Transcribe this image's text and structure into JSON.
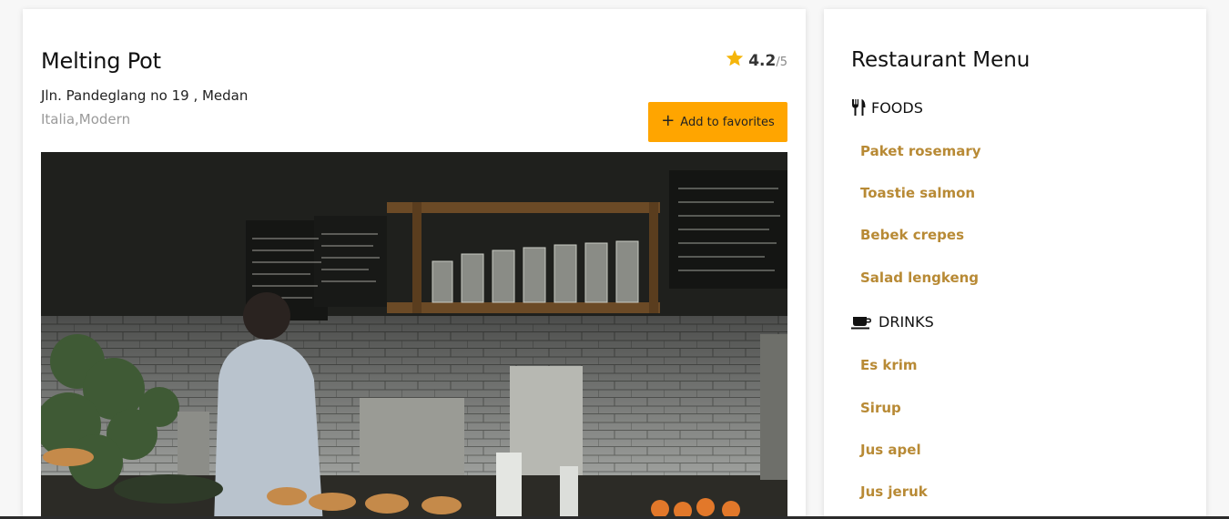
{
  "restaurant": {
    "name": "Melting Pot",
    "address": "Jln. Pandeglang no 19 , Medan",
    "cuisine": "Italia,Modern",
    "rating": "4.2",
    "rating_scale": "/5",
    "favorite_label": "Add to favorites",
    "favorite_icon": "plus-icon",
    "accent_color": "#ffa500",
    "star_color": "#f5b50a"
  },
  "menu": {
    "title": "Restaurant Menu",
    "item_color": "#b88a35",
    "foods": {
      "label": "FOODS",
      "icon": "utensils-icon",
      "items": [
        "Paket rosemary",
        "Toastie salmon",
        "Bebek crepes",
        "Salad lengkeng"
      ]
    },
    "drinks": {
      "label": "DRINKS",
      "icon": "coffee-cup-icon",
      "items": [
        "Es krim",
        "Sirup",
        "Jus apel",
        "Jus jeruk"
      ]
    }
  }
}
